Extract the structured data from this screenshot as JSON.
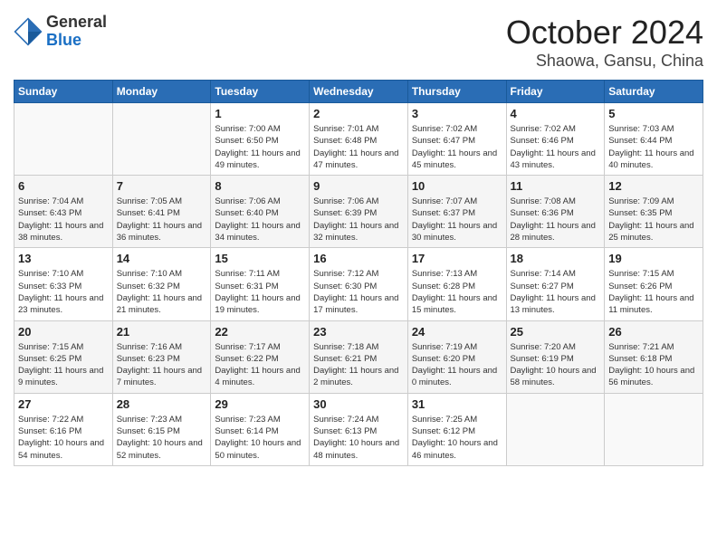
{
  "logo": {
    "general": "General",
    "blue": "Blue"
  },
  "title": {
    "month": "October 2024",
    "location": "Shaowa, Gansu, China"
  },
  "weekdays": [
    "Sunday",
    "Monday",
    "Tuesday",
    "Wednesday",
    "Thursday",
    "Friday",
    "Saturday"
  ],
  "weeks": [
    [
      {
        "day": "",
        "info": ""
      },
      {
        "day": "",
        "info": ""
      },
      {
        "day": "1",
        "info": "Sunrise: 7:00 AM\nSunset: 6:50 PM\nDaylight: 11 hours and 49 minutes."
      },
      {
        "day": "2",
        "info": "Sunrise: 7:01 AM\nSunset: 6:48 PM\nDaylight: 11 hours and 47 minutes."
      },
      {
        "day": "3",
        "info": "Sunrise: 7:02 AM\nSunset: 6:47 PM\nDaylight: 11 hours and 45 minutes."
      },
      {
        "day": "4",
        "info": "Sunrise: 7:02 AM\nSunset: 6:46 PM\nDaylight: 11 hours and 43 minutes."
      },
      {
        "day": "5",
        "info": "Sunrise: 7:03 AM\nSunset: 6:44 PM\nDaylight: 11 hours and 40 minutes."
      }
    ],
    [
      {
        "day": "6",
        "info": "Sunrise: 7:04 AM\nSunset: 6:43 PM\nDaylight: 11 hours and 38 minutes."
      },
      {
        "day": "7",
        "info": "Sunrise: 7:05 AM\nSunset: 6:41 PM\nDaylight: 11 hours and 36 minutes."
      },
      {
        "day": "8",
        "info": "Sunrise: 7:06 AM\nSunset: 6:40 PM\nDaylight: 11 hours and 34 minutes."
      },
      {
        "day": "9",
        "info": "Sunrise: 7:06 AM\nSunset: 6:39 PM\nDaylight: 11 hours and 32 minutes."
      },
      {
        "day": "10",
        "info": "Sunrise: 7:07 AM\nSunset: 6:37 PM\nDaylight: 11 hours and 30 minutes."
      },
      {
        "day": "11",
        "info": "Sunrise: 7:08 AM\nSunset: 6:36 PM\nDaylight: 11 hours and 28 minutes."
      },
      {
        "day": "12",
        "info": "Sunrise: 7:09 AM\nSunset: 6:35 PM\nDaylight: 11 hours and 25 minutes."
      }
    ],
    [
      {
        "day": "13",
        "info": "Sunrise: 7:10 AM\nSunset: 6:33 PM\nDaylight: 11 hours and 23 minutes."
      },
      {
        "day": "14",
        "info": "Sunrise: 7:10 AM\nSunset: 6:32 PM\nDaylight: 11 hours and 21 minutes."
      },
      {
        "day": "15",
        "info": "Sunrise: 7:11 AM\nSunset: 6:31 PM\nDaylight: 11 hours and 19 minutes."
      },
      {
        "day": "16",
        "info": "Sunrise: 7:12 AM\nSunset: 6:30 PM\nDaylight: 11 hours and 17 minutes."
      },
      {
        "day": "17",
        "info": "Sunrise: 7:13 AM\nSunset: 6:28 PM\nDaylight: 11 hours and 15 minutes."
      },
      {
        "day": "18",
        "info": "Sunrise: 7:14 AM\nSunset: 6:27 PM\nDaylight: 11 hours and 13 minutes."
      },
      {
        "day": "19",
        "info": "Sunrise: 7:15 AM\nSunset: 6:26 PM\nDaylight: 11 hours and 11 minutes."
      }
    ],
    [
      {
        "day": "20",
        "info": "Sunrise: 7:15 AM\nSunset: 6:25 PM\nDaylight: 11 hours and 9 minutes."
      },
      {
        "day": "21",
        "info": "Sunrise: 7:16 AM\nSunset: 6:23 PM\nDaylight: 11 hours and 7 minutes."
      },
      {
        "day": "22",
        "info": "Sunrise: 7:17 AM\nSunset: 6:22 PM\nDaylight: 11 hours and 4 minutes."
      },
      {
        "day": "23",
        "info": "Sunrise: 7:18 AM\nSunset: 6:21 PM\nDaylight: 11 hours and 2 minutes."
      },
      {
        "day": "24",
        "info": "Sunrise: 7:19 AM\nSunset: 6:20 PM\nDaylight: 11 hours and 0 minutes."
      },
      {
        "day": "25",
        "info": "Sunrise: 7:20 AM\nSunset: 6:19 PM\nDaylight: 10 hours and 58 minutes."
      },
      {
        "day": "26",
        "info": "Sunrise: 7:21 AM\nSunset: 6:18 PM\nDaylight: 10 hours and 56 minutes."
      }
    ],
    [
      {
        "day": "27",
        "info": "Sunrise: 7:22 AM\nSunset: 6:16 PM\nDaylight: 10 hours and 54 minutes."
      },
      {
        "day": "28",
        "info": "Sunrise: 7:23 AM\nSunset: 6:15 PM\nDaylight: 10 hours and 52 minutes."
      },
      {
        "day": "29",
        "info": "Sunrise: 7:23 AM\nSunset: 6:14 PM\nDaylight: 10 hours and 50 minutes."
      },
      {
        "day": "30",
        "info": "Sunrise: 7:24 AM\nSunset: 6:13 PM\nDaylight: 10 hours and 48 minutes."
      },
      {
        "day": "31",
        "info": "Sunrise: 7:25 AM\nSunset: 6:12 PM\nDaylight: 10 hours and 46 minutes."
      },
      {
        "day": "",
        "info": ""
      },
      {
        "day": "",
        "info": ""
      }
    ]
  ]
}
